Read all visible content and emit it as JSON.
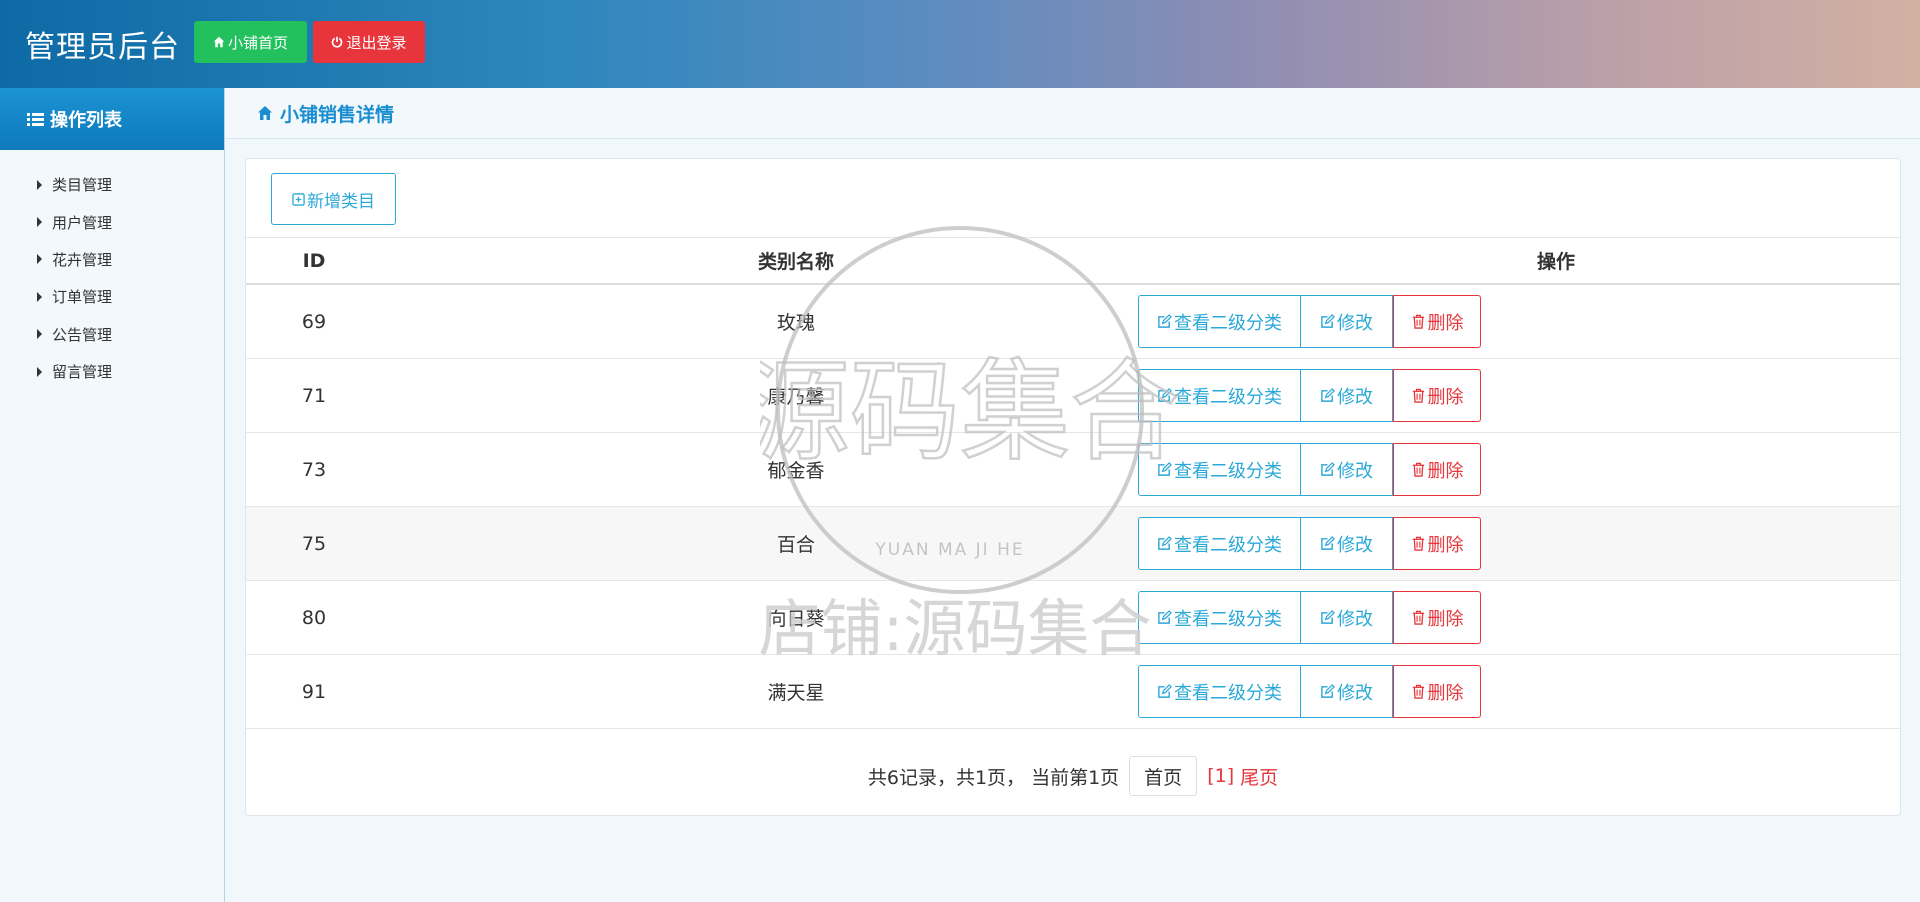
{
  "header": {
    "title": "管理员后台",
    "home_button": "小铺首页",
    "logout_button": "退出登录"
  },
  "sidebar": {
    "heading": "操作列表",
    "items": [
      {
        "label": "类目管理"
      },
      {
        "label": "用户管理"
      },
      {
        "label": "花卉管理"
      },
      {
        "label": "订单管理"
      },
      {
        "label": "公告管理"
      },
      {
        "label": "留言管理"
      }
    ]
  },
  "breadcrumb": {
    "title": "小铺销售详情"
  },
  "toolbar": {
    "add_button": "新增类目"
  },
  "table": {
    "columns": {
      "id": "ID",
      "name": "类别名称",
      "ops": "操作"
    },
    "actions": {
      "view": "查看二级分类",
      "edit": "修改",
      "delete": "删除"
    },
    "rows": [
      {
        "id": "69",
        "name": "玫瑰"
      },
      {
        "id": "71",
        "name": "康乃馨"
      },
      {
        "id": "73",
        "name": "郁金香"
      },
      {
        "id": "75",
        "name": "百合"
      },
      {
        "id": "80",
        "name": "向日葵"
      },
      {
        "id": "91",
        "name": "满天星"
      }
    ]
  },
  "pagination": {
    "summary": "共6记录，共1页， 当前第1页",
    "first": "首页",
    "current": "[1]",
    "last": "尾页"
  },
  "watermark": {
    "main_chars": "源码集合",
    "latin": "YUAN MA JI HE",
    "shop_line": "店铺:源码集合"
  },
  "colors": {
    "accent": "#1a8ed0",
    "primary_outline": "#2aa8d8",
    "success": "#23c15e",
    "danger": "#e7353b"
  }
}
